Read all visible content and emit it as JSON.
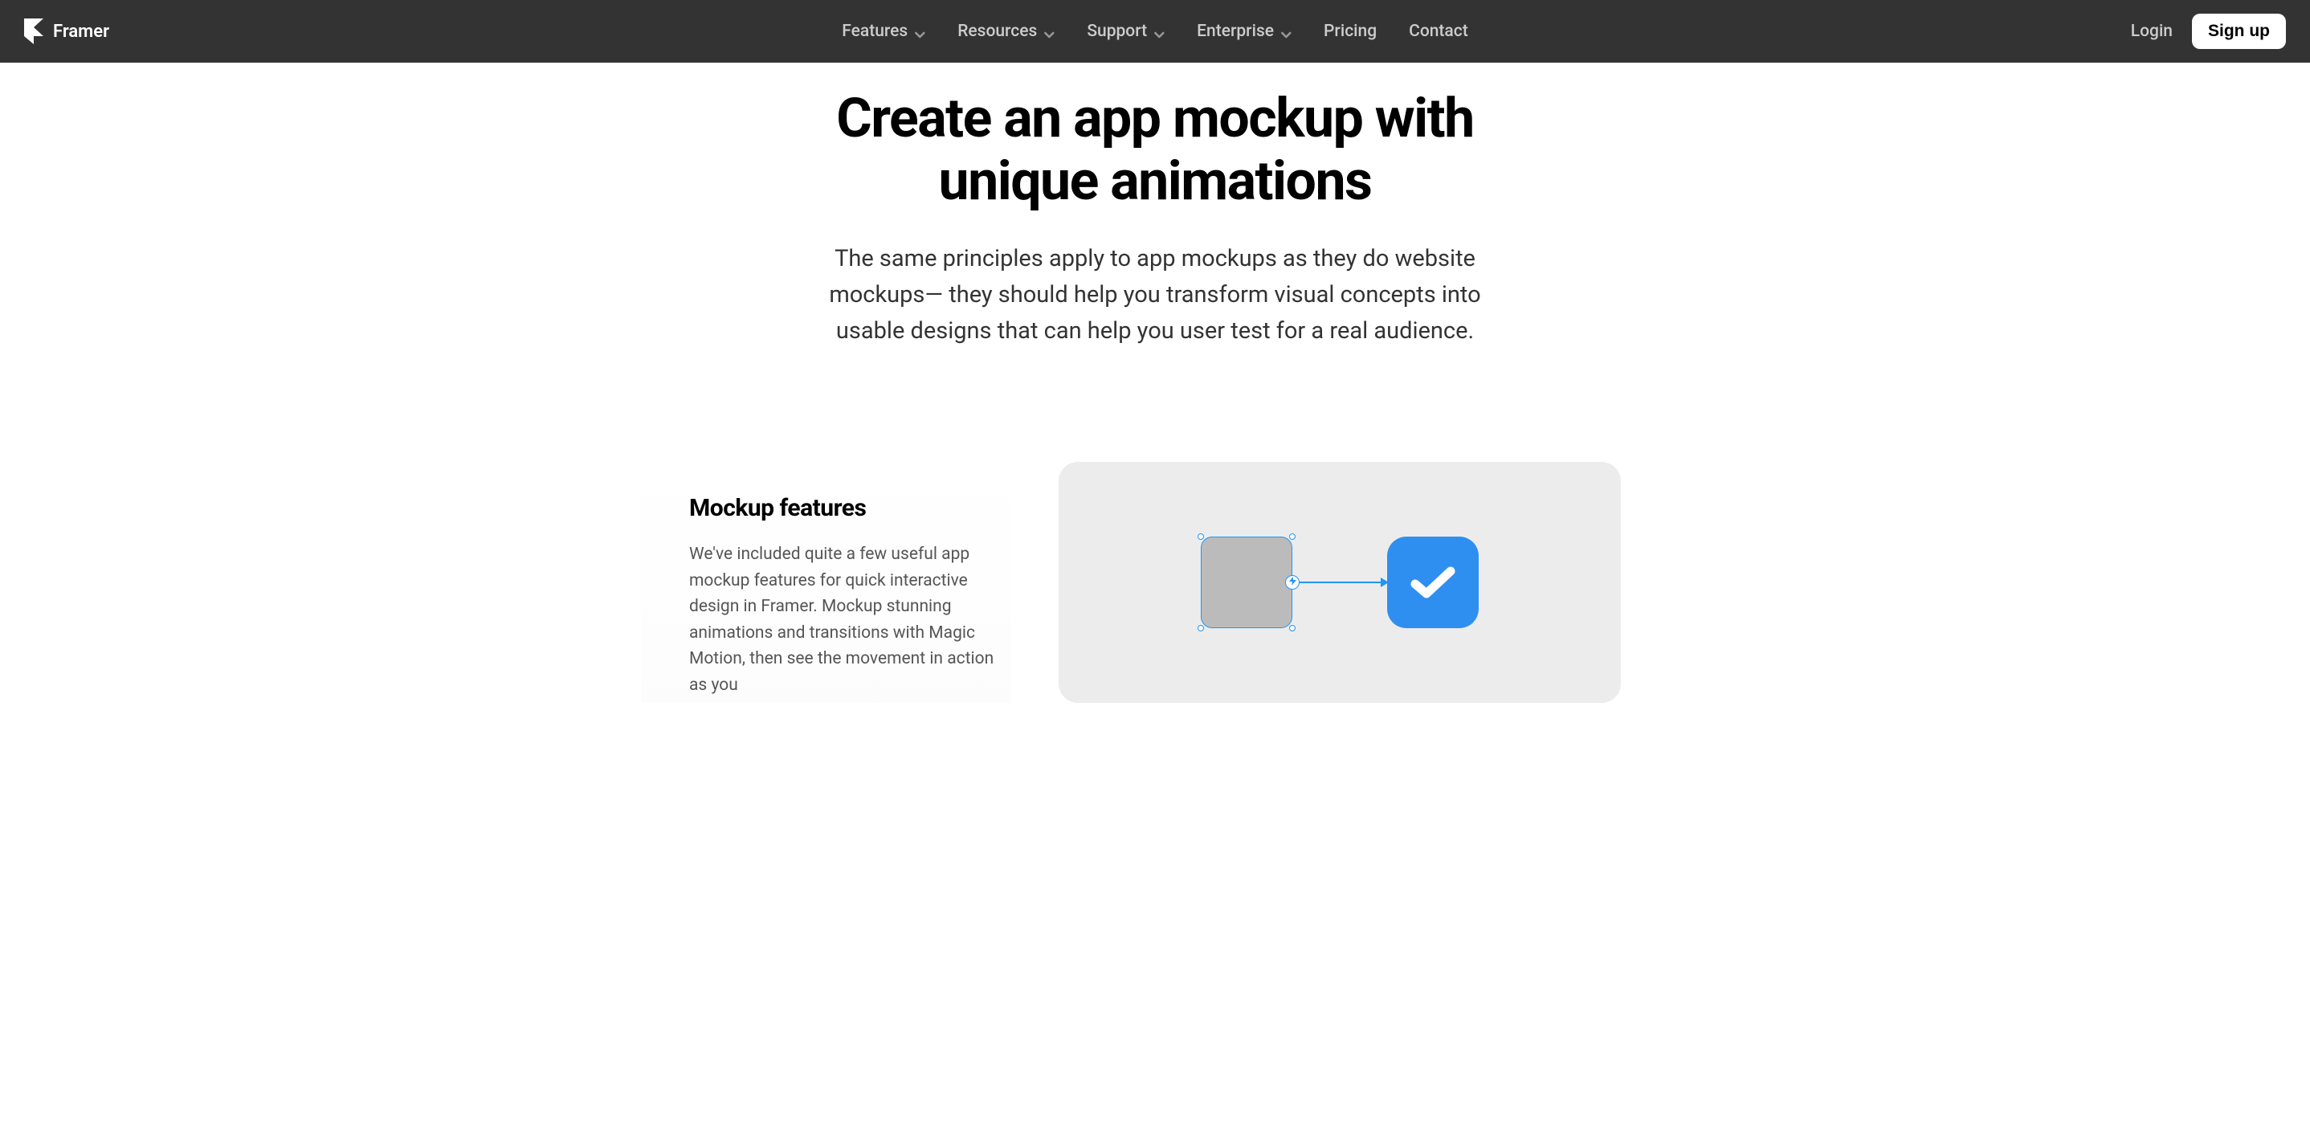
{
  "navbar": {
    "brand": "Framer",
    "items": [
      {
        "label": "Features",
        "hasDropdown": true
      },
      {
        "label": "Resources",
        "hasDropdown": true
      },
      {
        "label": "Support",
        "hasDropdown": true
      },
      {
        "label": "Enterprise",
        "hasDropdown": true
      },
      {
        "label": "Pricing",
        "hasDropdown": false
      },
      {
        "label": "Contact",
        "hasDropdown": false
      }
    ],
    "login": "Login",
    "signup": "Sign up"
  },
  "hero": {
    "title": "Create an app mockup with unique animations",
    "subtitle": "The same principles apply to app mockups as they do website mockups— they should help you transform visual concepts into usable designs that can help you user test for a real audience."
  },
  "features": {
    "title": "Mockup features",
    "body": "We've included quite a few useful app mockup features for quick interactive design in Framer. Mockup stunning animations and transitions with Magic Motion, then see the movement in action as you"
  },
  "colors": {
    "navbar": "#333333",
    "accent": "#2f8ff0",
    "selectionBorder": "#2196f3",
    "grayBox": "#bbbbbb",
    "lightGray": "#ececec"
  }
}
